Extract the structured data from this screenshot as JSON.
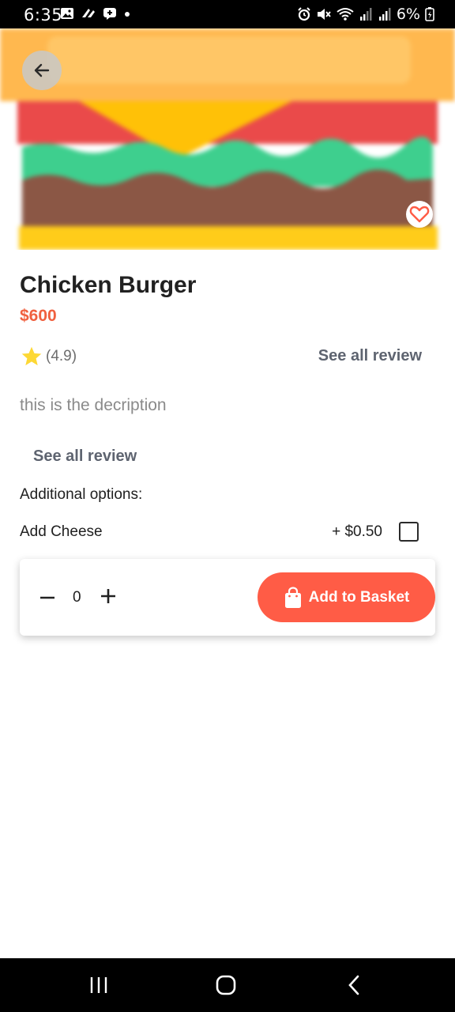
{
  "status_bar": {
    "time": "6:35",
    "battery": "6%",
    "icons": [
      "image-icon",
      "slack-icon",
      "message-icon",
      "dot-icon",
      "alarm-icon",
      "mute-icon",
      "wifi-icon",
      "signal-icon",
      "signal-icon",
      "battery-charging-icon"
    ]
  },
  "product": {
    "title": "Chicken Burger",
    "price": "$600",
    "rating": "(4.9)",
    "see_all_top": "See all review",
    "description": "this is the decription",
    "see_all_bottom": "See all review"
  },
  "options": {
    "heading": "Additional options:",
    "items": [
      {
        "name": "Add Cheese",
        "price": "+ $0.50",
        "checked": false
      }
    ]
  },
  "basket": {
    "quantity": "0",
    "add_label": "Add to Basket"
  },
  "colors": {
    "accent": "#ff5c46",
    "price": "#f0603f",
    "star": "#fdd835"
  }
}
